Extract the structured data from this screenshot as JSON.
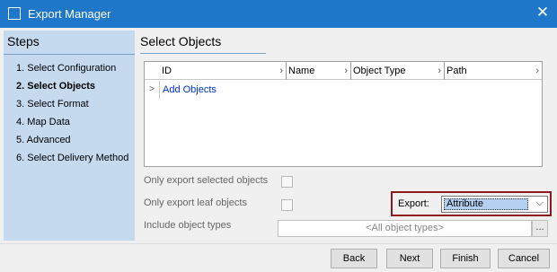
{
  "window": {
    "title": "Export Manager"
  },
  "sidebar": {
    "title": "Steps",
    "steps": [
      {
        "label": "1. Select Configuration",
        "active": false
      },
      {
        "label": "2. Select Objects",
        "active": true
      },
      {
        "label": "3. Select Format",
        "active": false
      },
      {
        "label": "4. Map Data",
        "active": false
      },
      {
        "label": "5. Advanced",
        "active": false
      },
      {
        "label": "6. Select Delivery Method",
        "active": false
      }
    ]
  },
  "main": {
    "title": "Select Objects",
    "grid": {
      "columns": [
        "ID",
        "Name",
        "Object Type",
        "Path"
      ],
      "add_link": "Add Objects",
      "row_marker": ">"
    },
    "options": {
      "only_selected_label": "Only export selected objects",
      "only_leaf_label": "Only export leaf objects",
      "include_types_label": "Include object types",
      "include_types_value": "<All object types>",
      "ellipsis": "..."
    },
    "export": {
      "label": "Export:",
      "value": "Attribute"
    }
  },
  "buttons": {
    "back": "Back",
    "next": "Next",
    "finish": "Finish",
    "cancel": "Cancel"
  }
}
